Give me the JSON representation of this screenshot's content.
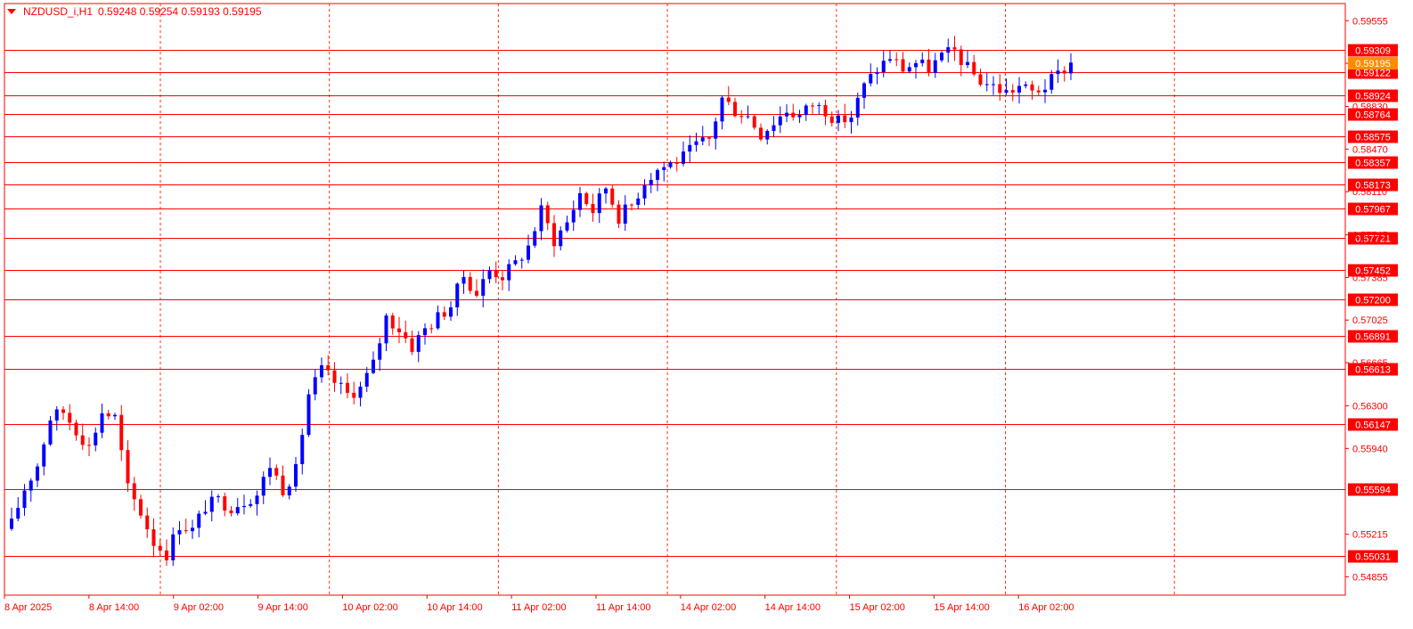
{
  "header": {
    "symbol_timeframe": "NZDUSD_i,H1",
    "ohlc": "0.59248 0.59254 0.59193 0.59195"
  },
  "colors": {
    "background": "#ffffff",
    "frame": "#ff0000",
    "level_line": "#ff0000",
    "grid": "#ff3300",
    "bull_candle": "#0000ff",
    "bear_candle": "#ff0000",
    "label_bg": "#ff0000",
    "label_text": "#ffffff",
    "axis_text": "#ff0000",
    "current_price_bg": "#ff8c00"
  },
  "chart_data": {
    "type": "candlestick",
    "symbol": "NZDUSD_i",
    "timeframe": "H1",
    "ylim": [
      0.547,
      0.597
    ],
    "grid": true,
    "price_scale_ticks": [
      "0.59555",
      "0.59195",
      "0.58830",
      "0.58470",
      "0.58110",
      "0.57745",
      "0.57385",
      "0.57025",
      "0.56665",
      "0.56300",
      "0.55940",
      "0.55215",
      "0.54855"
    ],
    "time_ticks": [
      "8 Apr 2025",
      "8 Apr 14:00",
      "9 Apr 02:00",
      "9 Apr 14:00",
      "10 Apr 02:00",
      "10 Apr 14:00",
      "11 Apr 02:00",
      "11 Apr 14:00",
      "14 Apr 02:00",
      "14 Apr 14:00",
      "15 Apr 02:00",
      "15 Apr 14:00",
      "16 Apr 02:00"
    ],
    "levels": [
      "0.59309",
      "0.59122",
      "0.58924",
      "0.58764",
      "0.58575",
      "0.58357",
      "0.58173",
      "0.57967",
      "0.57721",
      "0.57452",
      "0.57200",
      "0.56891",
      "0.56613",
      "0.56147",
      "0.55594",
      "0.55031"
    ],
    "current_price": "0.59195",
    "close_path": [
      [
        0,
        0.553
      ],
      [
        2,
        0.556
      ],
      [
        4,
        0.558
      ],
      [
        6,
        0.562
      ],
      [
        8,
        0.5625
      ],
      [
        10,
        0.561
      ],
      [
        12,
        0.5595
      ],
      [
        14,
        0.5625
      ],
      [
        16,
        0.562
      ],
      [
        18,
        0.556
      ],
      [
        20,
        0.554
      ],
      [
        22,
        0.5515
      ],
      [
        24,
        0.5505
      ],
      [
        26,
        0.553
      ],
      [
        28,
        0.5525
      ],
      [
        30,
        0.5545
      ],
      [
        32,
        0.555
      ],
      [
        34,
        0.5545
      ],
      [
        36,
        0.555
      ],
      [
        38,
        0.5555
      ],
      [
        40,
        0.558
      ],
      [
        42,
        0.556
      ],
      [
        44,
        0.5575
      ],
      [
        46,
        0.564
      ],
      [
        48,
        0.566
      ],
      [
        50,
        0.565
      ],
      [
        52,
        0.564
      ],
      [
        54,
        0.5645
      ],
      [
        56,
        0.5665
      ],
      [
        58,
        0.5705
      ],
      [
        60,
        0.5695
      ],
      [
        62,
        0.568
      ],
      [
        64,
        0.5695
      ],
      [
        66,
        0.5705
      ],
      [
        68,
        0.5715
      ],
      [
        70,
        0.574
      ],
      [
        72,
        0.5725
      ],
      [
        74,
        0.5745
      ],
      [
        76,
        0.574
      ],
      [
        78,
        0.575
      ],
      [
        80,
        0.5765
      ],
      [
        82,
        0.5795
      ],
      [
        84,
        0.577
      ],
      [
        86,
        0.5785
      ],
      [
        88,
        0.581
      ],
      [
        90,
        0.5795
      ],
      [
        92,
        0.5815
      ],
      [
        94,
        0.579
      ],
      [
        96,
        0.58
      ],
      [
        98,
        0.582
      ],
      [
        100,
        0.583
      ],
      [
        102,
        0.5835
      ],
      [
        104,
        0.584
      ],
      [
        106,
        0.585
      ],
      [
        108,
        0.5855
      ],
      [
        110,
        0.589
      ],
      [
        112,
        0.588
      ],
      [
        114,
        0.5875
      ],
      [
        116,
        0.586
      ],
      [
        118,
        0.587
      ],
      [
        120,
        0.588
      ],
      [
        122,
        0.5875
      ],
      [
        124,
        0.5885
      ],
      [
        126,
        0.588
      ],
      [
        128,
        0.587
      ],
      [
        130,
        0.5875
      ],
      [
        132,
        0.59
      ],
      [
        134,
        0.5915
      ],
      [
        136,
        0.5925
      ],
      [
        138,
        0.5915
      ],
      [
        140,
        0.592
      ],
      [
        142,
        0.5915
      ],
      [
        144,
        0.5925
      ],
      [
        146,
        0.593
      ],
      [
        148,
        0.5915
      ],
      [
        150,
        0.5905
      ],
      [
        152,
        0.59
      ],
      [
        154,
        0.5895
      ],
      [
        156,
        0.59
      ],
      [
        158,
        0.5895
      ],
      [
        160,
        0.59
      ],
      [
        162,
        0.591
      ],
      [
        164,
        0.592
      ]
    ],
    "candle_count": 165
  }
}
